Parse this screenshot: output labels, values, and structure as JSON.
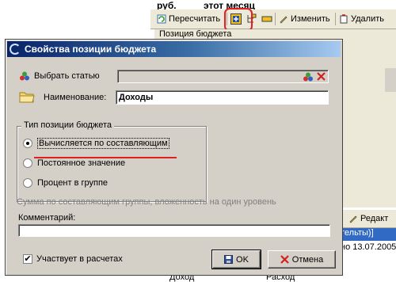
{
  "background": {
    "currency_label": "руб.",
    "period_label": "этот месяц",
    "toolbar": {
      "recalculate": "Пересчитать",
      "edit": "Изменить",
      "delete": "Удалить"
    },
    "column_header": "Позиция бюджета",
    "lower_toolbar_edit": "Редакт",
    "selected_row": "тельты)]",
    "info_row": "но 13.07.2005",
    "bottom_cell_1": "Доход",
    "bottom_cell_2": "Расход"
  },
  "dialog": {
    "title": "Свойства позиции бюджета",
    "select_item_label": "Выбрать статью",
    "select_item_value": "",
    "name_label": "Наименование:",
    "name_value": "Доходы",
    "group_title": "Тип позиции бюджета",
    "radio_options": [
      {
        "label": "Вычисляется по составляющим",
        "checked": true
      },
      {
        "label": "Постоянное значение",
        "checked": false
      },
      {
        "label": "Процент в группе",
        "checked": false
      }
    ],
    "hint": "Сумма по составляющим группы, вложенность на один уровень",
    "comment_label": "Комментарий:",
    "comment_value": "",
    "participates_label": "Участвует в расчетах",
    "participates_checked": true,
    "ok_label": "OK",
    "cancel_label": "Отмена"
  },
  "colors": {
    "title_gradient_start": "#0a246a",
    "dialog_face": "#d4d0c8",
    "highlight_annotation": "#e02020",
    "selection": "#316ac5"
  }
}
